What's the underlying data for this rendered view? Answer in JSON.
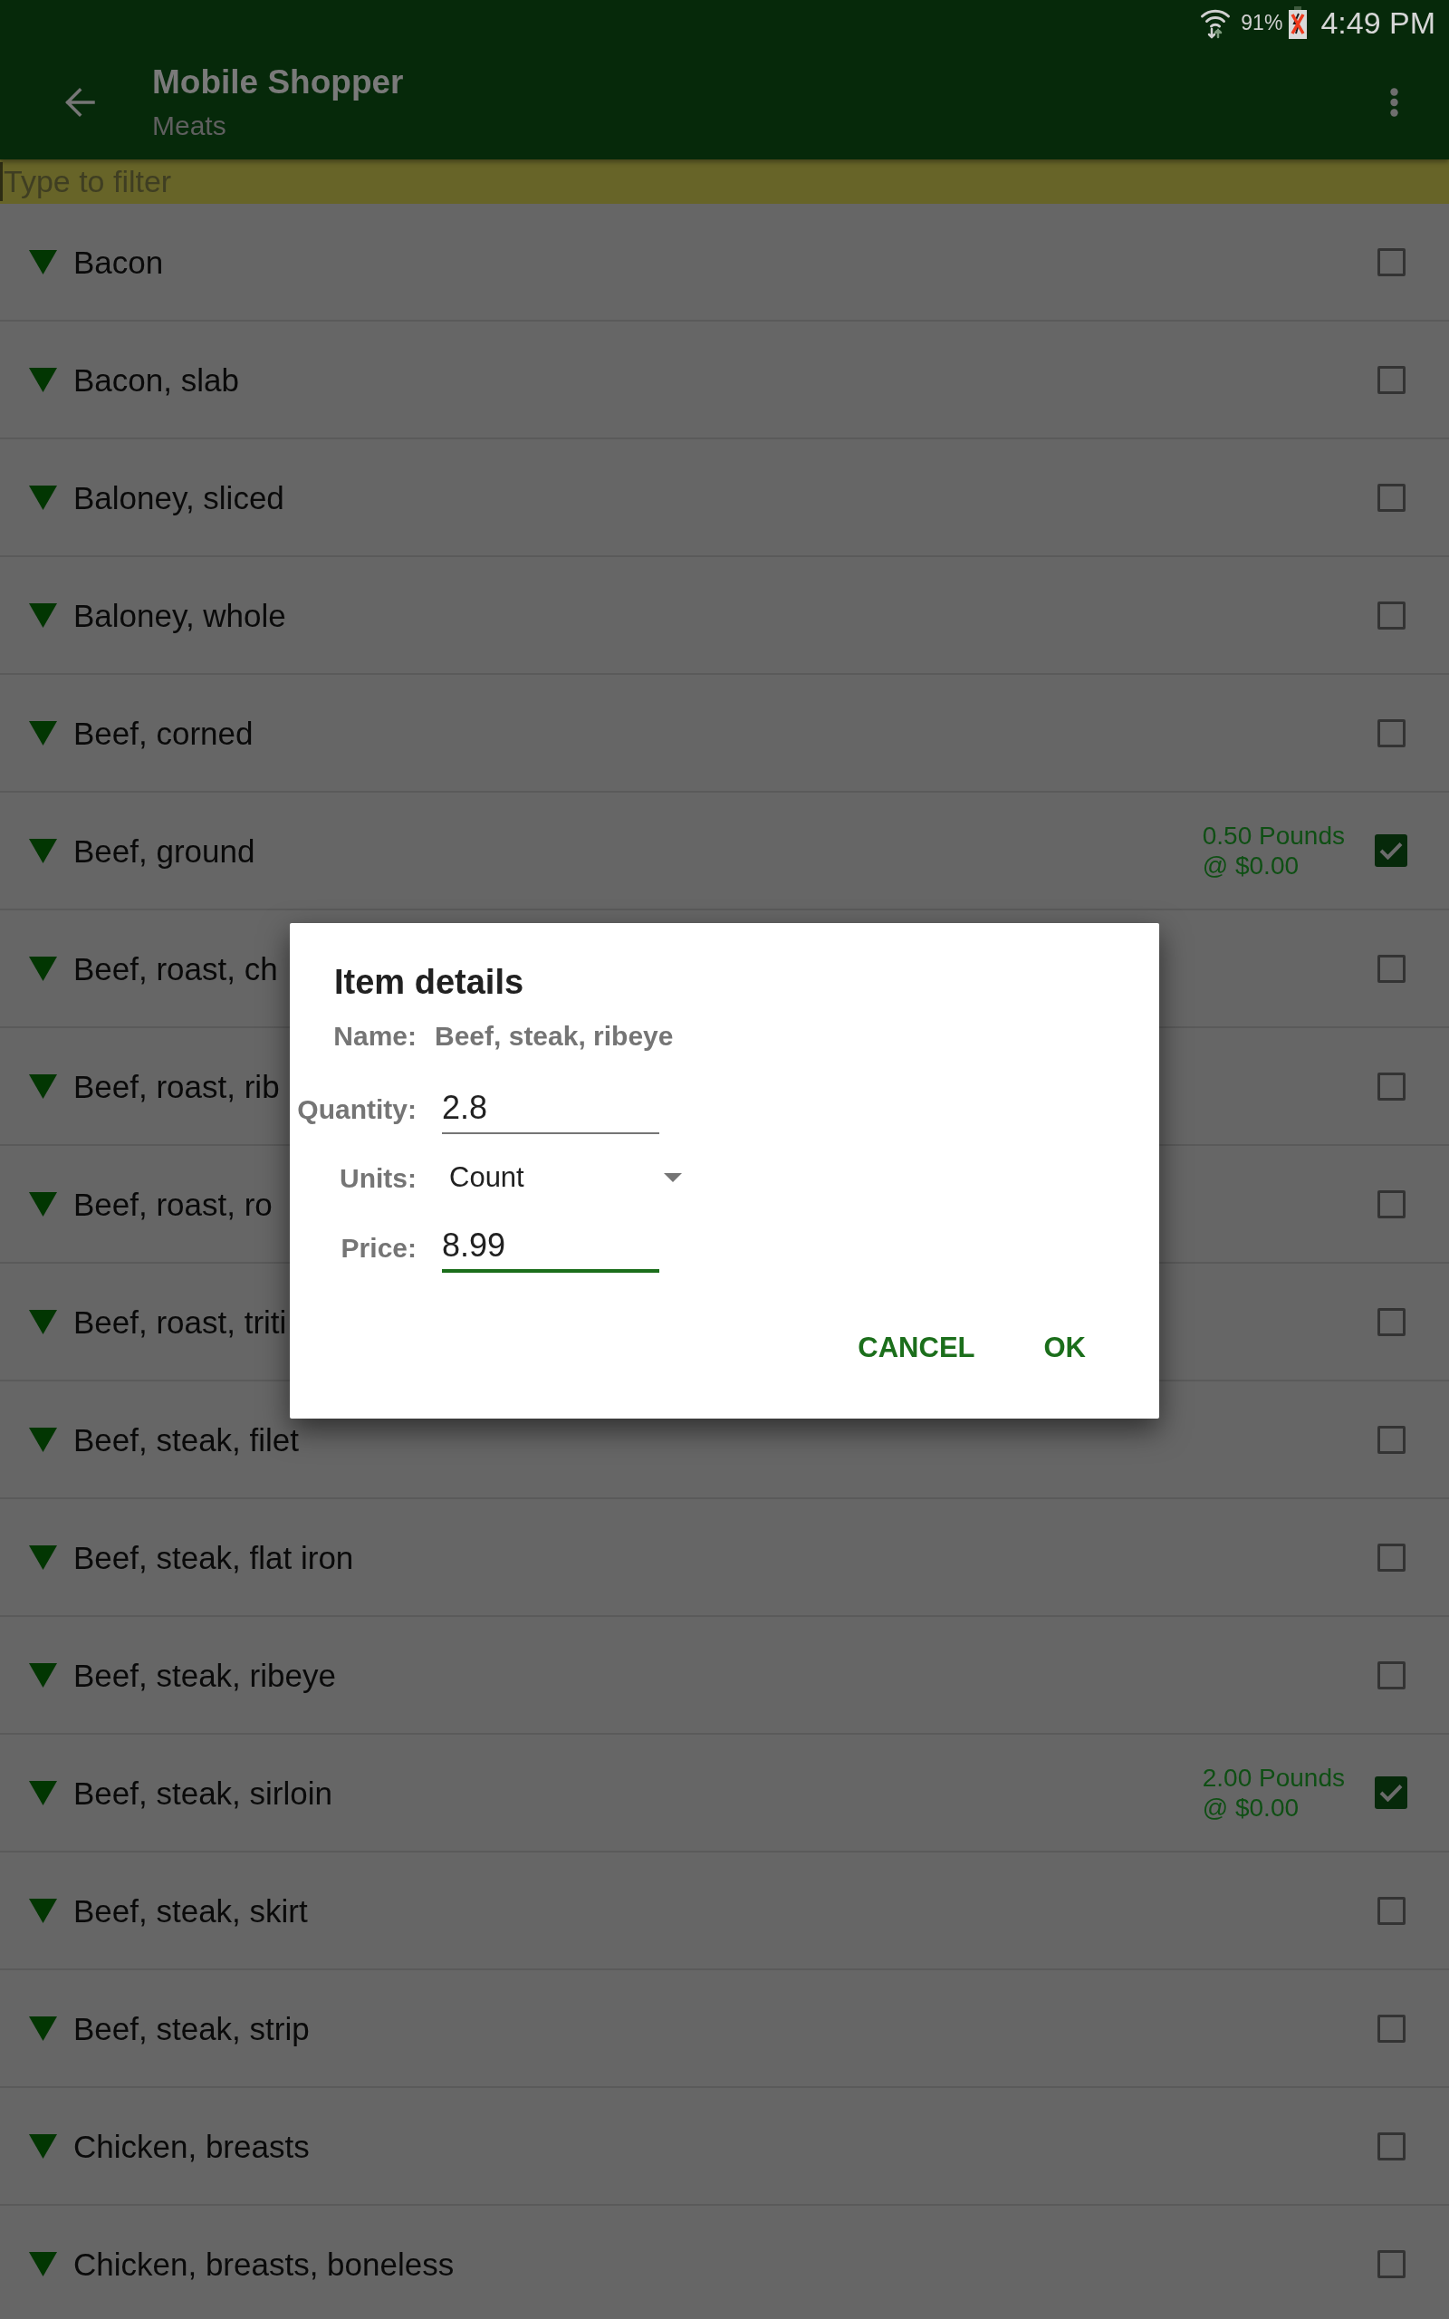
{
  "status_bar": {
    "battery": "91%",
    "time": "4:49 PM"
  },
  "app_bar": {
    "title": "Mobile Shopper",
    "subtitle": "Meats"
  },
  "filter": {
    "placeholder": "Type to filter"
  },
  "items": [
    {
      "name": "Bacon",
      "checked": false
    },
    {
      "name": "Bacon, slab",
      "checked": false
    },
    {
      "name": "Baloney, sliced",
      "checked": false
    },
    {
      "name": "Baloney, whole",
      "checked": false
    },
    {
      "name": "Beef, corned",
      "checked": false
    },
    {
      "name": "Beef, ground",
      "checked": true,
      "amount": "0.50 Pounds",
      "price": "@ $0.00"
    },
    {
      "name": "Beef, roast, ch",
      "checked": false
    },
    {
      "name": "Beef, roast, rib",
      "checked": false
    },
    {
      "name": "Beef, roast, ro",
      "checked": false
    },
    {
      "name": "Beef, roast, triti",
      "checked": false
    },
    {
      "name": "Beef, steak, filet",
      "checked": false
    },
    {
      "name": "Beef, steak, flat iron",
      "checked": false
    },
    {
      "name": "Beef, steak, ribeye",
      "checked": false
    },
    {
      "name": "Beef, steak, sirloin",
      "checked": true,
      "amount": "2.00 Pounds",
      "price": "@ $0.00"
    },
    {
      "name": "Beef, steak, skirt",
      "checked": false
    },
    {
      "name": "Beef, steak, strip",
      "checked": false
    },
    {
      "name": "Chicken, breasts",
      "checked": false
    },
    {
      "name": "Chicken, breasts, boneless",
      "checked": false
    }
  ],
  "dialog": {
    "title": "Item details",
    "fields": [
      {
        "kind": "text",
        "label": "Name:",
        "value": "Beef, steak, ribeye"
      },
      {
        "kind": "input",
        "label": "Quantity:",
        "value": "2.8",
        "focused": false
      },
      {
        "kind": "dropdown",
        "label": "Units:",
        "value": "Count"
      },
      {
        "kind": "input",
        "label": "Price:",
        "value": "8.99",
        "focused": true
      }
    ],
    "buttons": [
      "CANCEL",
      "OK"
    ]
  }
}
